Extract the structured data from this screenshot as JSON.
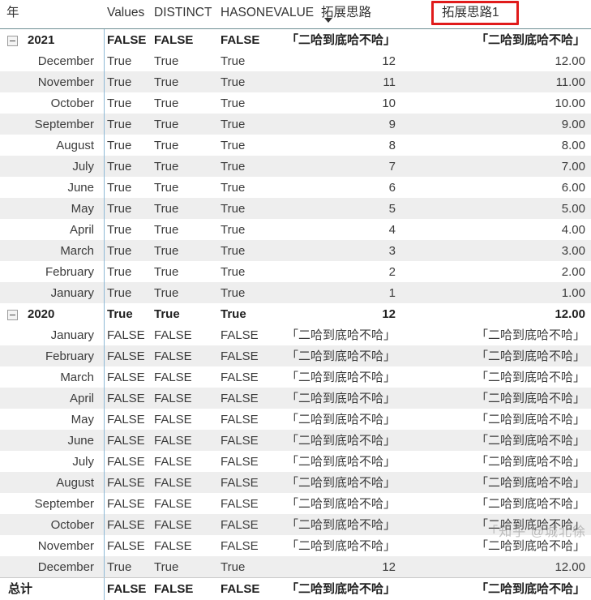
{
  "header": {
    "row_label": "年",
    "columns": [
      {
        "label": "Values",
        "key": "values"
      },
      {
        "label": "DISTINCT",
        "key": "distinct"
      },
      {
        "label": "HASONEVALUE",
        "key": "hasone"
      },
      {
        "label": "拓展思路",
        "key": "tz",
        "sort_indicator": "▼"
      },
      {
        "label": "拓展思路1",
        "key": "tz1",
        "highlight": true
      }
    ],
    "highlight_color": "#e01b1b"
  },
  "placeholder_text": "「二哈到底哈不哈」",
  "watermark": "「知乎 @城北徐",
  "rows": [
    {
      "type": "group",
      "label": "2021",
      "expander": "collapse-minus-icon",
      "values": "FALSE",
      "distinct": "FALSE",
      "hasone": "FALSE",
      "tz": "「二哈到底哈不哈」",
      "tz1": "「二哈到底哈不哈」"
    },
    {
      "type": "data",
      "label": "December",
      "values": "True",
      "distinct": "True",
      "hasone": "True",
      "tz": "12",
      "tz1": "12.00"
    },
    {
      "type": "data",
      "label": "November",
      "values": "True",
      "distinct": "True",
      "hasone": "True",
      "tz": "11",
      "tz1": "11.00"
    },
    {
      "type": "data",
      "label": "October",
      "values": "True",
      "distinct": "True",
      "hasone": "True",
      "tz": "10",
      "tz1": "10.00"
    },
    {
      "type": "data",
      "label": "September",
      "values": "True",
      "distinct": "True",
      "hasone": "True",
      "tz": "9",
      "tz1": "9.00"
    },
    {
      "type": "data",
      "label": "August",
      "values": "True",
      "distinct": "True",
      "hasone": "True",
      "tz": "8",
      "tz1": "8.00"
    },
    {
      "type": "data",
      "label": "July",
      "values": "True",
      "distinct": "True",
      "hasone": "True",
      "tz": "7",
      "tz1": "7.00"
    },
    {
      "type": "data",
      "label": "June",
      "values": "True",
      "distinct": "True",
      "hasone": "True",
      "tz": "6",
      "tz1": "6.00"
    },
    {
      "type": "data",
      "label": "May",
      "values": "True",
      "distinct": "True",
      "hasone": "True",
      "tz": "5",
      "tz1": "5.00"
    },
    {
      "type": "data",
      "label": "April",
      "values": "True",
      "distinct": "True",
      "hasone": "True",
      "tz": "4",
      "tz1": "4.00"
    },
    {
      "type": "data",
      "label": "March",
      "values": "True",
      "distinct": "True",
      "hasone": "True",
      "tz": "3",
      "tz1": "3.00"
    },
    {
      "type": "data",
      "label": "February",
      "values": "True",
      "distinct": "True",
      "hasone": "True",
      "tz": "2",
      "tz1": "2.00"
    },
    {
      "type": "data",
      "label": "January",
      "values": "True",
      "distinct": "True",
      "hasone": "True",
      "tz": "1",
      "tz1": "1.00"
    },
    {
      "type": "group",
      "label": "2020",
      "expander": "collapse-minus-icon",
      "values": "True",
      "distinct": "True",
      "hasone": "True",
      "tz": "12",
      "tz1": "12.00"
    },
    {
      "type": "data",
      "label": "January",
      "values": "FALSE",
      "distinct": "FALSE",
      "hasone": "FALSE",
      "tz": "「二哈到底哈不哈」",
      "tz1": "「二哈到底哈不哈」"
    },
    {
      "type": "data",
      "label": "February",
      "values": "FALSE",
      "distinct": "FALSE",
      "hasone": "FALSE",
      "tz": "「二哈到底哈不哈」",
      "tz1": "「二哈到底哈不哈」"
    },
    {
      "type": "data",
      "label": "March",
      "values": "FALSE",
      "distinct": "FALSE",
      "hasone": "FALSE",
      "tz": "「二哈到底哈不哈」",
      "tz1": "「二哈到底哈不哈」"
    },
    {
      "type": "data",
      "label": "April",
      "values": "FALSE",
      "distinct": "FALSE",
      "hasone": "FALSE",
      "tz": "「二哈到底哈不哈」",
      "tz1": "「二哈到底哈不哈」"
    },
    {
      "type": "data",
      "label": "May",
      "values": "FALSE",
      "distinct": "FALSE",
      "hasone": "FALSE",
      "tz": "「二哈到底哈不哈」",
      "tz1": "「二哈到底哈不哈」"
    },
    {
      "type": "data",
      "label": "June",
      "values": "FALSE",
      "distinct": "FALSE",
      "hasone": "FALSE",
      "tz": "「二哈到底哈不哈」",
      "tz1": "「二哈到底哈不哈」"
    },
    {
      "type": "data",
      "label": "July",
      "values": "FALSE",
      "distinct": "FALSE",
      "hasone": "FALSE",
      "tz": "「二哈到底哈不哈」",
      "tz1": "「二哈到底哈不哈」"
    },
    {
      "type": "data",
      "label": "August",
      "values": "FALSE",
      "distinct": "FALSE",
      "hasone": "FALSE",
      "tz": "「二哈到底哈不哈」",
      "tz1": "「二哈到底哈不哈」"
    },
    {
      "type": "data",
      "label": "September",
      "values": "FALSE",
      "distinct": "FALSE",
      "hasone": "FALSE",
      "tz": "「二哈到底哈不哈」",
      "tz1": "「二哈到底哈不哈」"
    },
    {
      "type": "data",
      "label": "October",
      "values": "FALSE",
      "distinct": "FALSE",
      "hasone": "FALSE",
      "tz": "「二哈到底哈不哈」",
      "tz1": "「二哈到底哈不哈」"
    },
    {
      "type": "data",
      "label": "November",
      "values": "FALSE",
      "distinct": "FALSE",
      "hasone": "FALSE",
      "tz": "「二哈到底哈不哈」",
      "tz1": "「二哈到底哈不哈」"
    },
    {
      "type": "data",
      "label": "December",
      "values": "True",
      "distinct": "True",
      "hasone": "True",
      "tz": "12",
      "tz1": "12.00"
    },
    {
      "type": "total",
      "label": "总计",
      "values": "FALSE",
      "distinct": "FALSE",
      "hasone": "FALSE",
      "tz": "「二哈到底哈不哈」",
      "tz1": "「二哈到底哈不哈」"
    }
  ]
}
